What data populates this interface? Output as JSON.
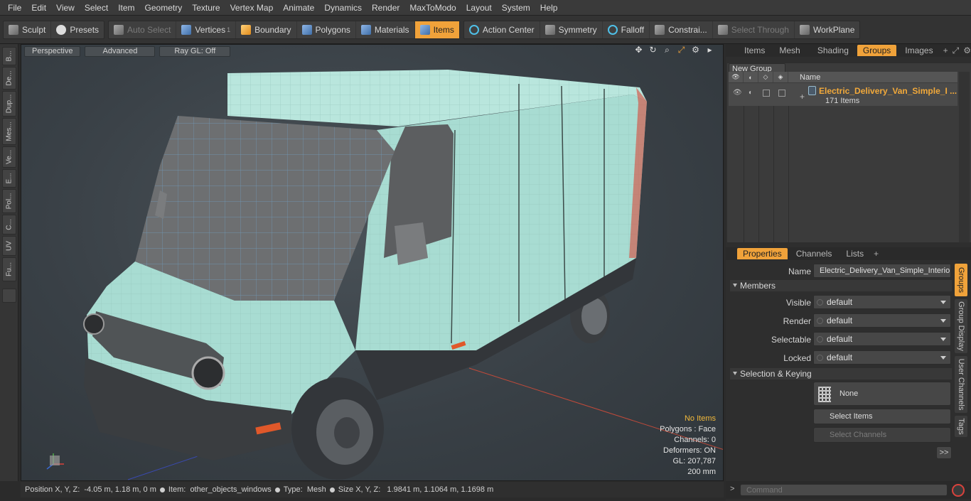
{
  "menu": [
    "File",
    "Edit",
    "View",
    "Select",
    "Item",
    "Geometry",
    "Texture",
    "Vertex Map",
    "Animate",
    "Dynamics",
    "Render",
    "MaxToModo",
    "Layout",
    "System",
    "Help"
  ],
  "toolbar": {
    "sculpt": "Sculpt",
    "presets": "Presets",
    "auto_select": "Auto Select",
    "vertices": "Vertices",
    "vertices_count": "1",
    "boundary": "Boundary",
    "polygons": "Polygons",
    "materials": "Materials",
    "items": "Items",
    "action_center": "Action Center",
    "symmetry": "Symmetry",
    "falloff": "Falloff",
    "constraints": "Constrai...",
    "select_through": "Select Through",
    "workplane": "WorkPlane"
  },
  "left_tabs": [
    "B...",
    "De...",
    "Dup...",
    "Mes...",
    "Ve...",
    "E...",
    "Pol...",
    "C...",
    "UV",
    "Fu..."
  ],
  "viewport": {
    "view_mode": "Perspective",
    "shading": "Advanced",
    "raygl": "Ray GL: Off",
    "stats": {
      "selection": "No Items",
      "polygons": "Polygons : Face",
      "channels": "Channels: 0",
      "deformers": "Deformers: ON",
      "gl": "GL: 207,787",
      "scale": "200 mm"
    }
  },
  "statusbar": {
    "position_label": "Position X, Y, Z:",
    "position_value": "-4.05 m, 1.18 m, 0 m",
    "item_label": "Item:",
    "item_value": "other_objects_windows",
    "type_label": "Type:",
    "type_value": "Mesh",
    "size_label": "Size X, Y, Z:",
    "size_value": "1.9841 m, 1.1064 m, 1.1698 m"
  },
  "right_panel": {
    "top_tabs": [
      "Items",
      "Mesh ...",
      "Shading",
      "Groups",
      "Images"
    ],
    "active_top_tab": "Groups",
    "new_group": "New Group",
    "name_header": "Name",
    "group_name": "Electric_Delivery_Van_Simple_I ...",
    "group_count": "171 Items",
    "bottom_tabs": [
      "Properties",
      "Channels",
      "Lists"
    ],
    "name_label": "Name",
    "name_value": "Electric_Delivery_Van_Simple_Interior",
    "members_label": "Members",
    "visible_label": "Visible",
    "visible_value": "default",
    "render_label": "Render",
    "render_value": "default",
    "selectable_label": "Selectable",
    "selectable_value": "default",
    "locked_label": "Locked",
    "locked_value": "default",
    "selkey_label": "Selection & Keying",
    "none_label": "None",
    "select_items": "Select Items",
    "select_channels": "Select Channels",
    "more": ">>",
    "side_tabs": [
      "Groups",
      "Group Display",
      "User Channels",
      "Tags"
    ],
    "command_placeholder": "Command"
  },
  "colors": {
    "accent": "#f0a23a",
    "van_body": "#a8dcd2",
    "highlight_text": "#f2b93b"
  }
}
